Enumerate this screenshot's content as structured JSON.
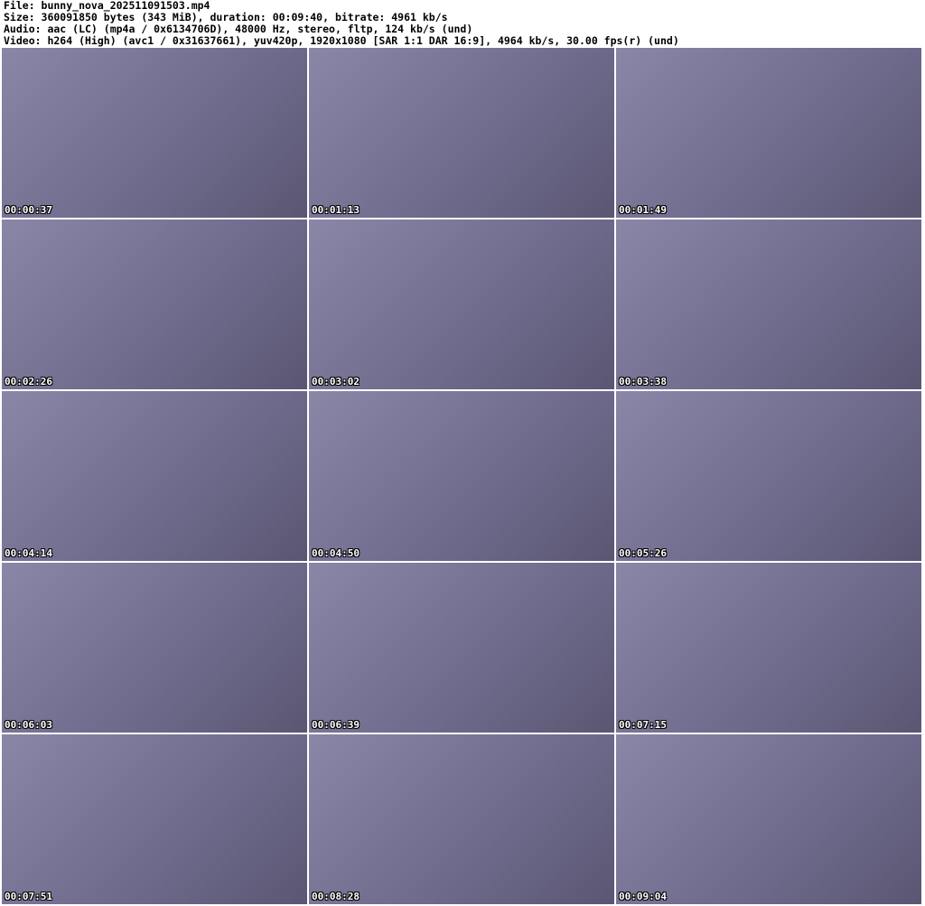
{
  "header": {
    "file_line": "File: bunny_nova_202511091503.mp4",
    "size_line": "Size: 360091850 bytes (343 MiB), duration: 00:09:40, bitrate: 4961 kb/s",
    "audio_line": "Audio: aac (LC) (mp4a / 0x6134706D), 48000 Hz, stereo, fltp, 124 kb/s (und)",
    "video_line": "Video: h264 (High) (avc1 / 0x31637661), yuv420p, 1920x1080 [SAR 1:1 DAR 16:9], 4964 kb/s, 30.00 fps(r) (und)"
  },
  "thumbnails": [
    "00:00:37",
    "00:01:13",
    "00:01:49",
    "00:02:26",
    "00:03:02",
    "00:03:38",
    "00:04:14",
    "00:04:50",
    "00:05:26",
    "00:06:03",
    "00:06:39",
    "00:07:15",
    "00:07:51",
    "00:08:28",
    "00:09:04"
  ]
}
